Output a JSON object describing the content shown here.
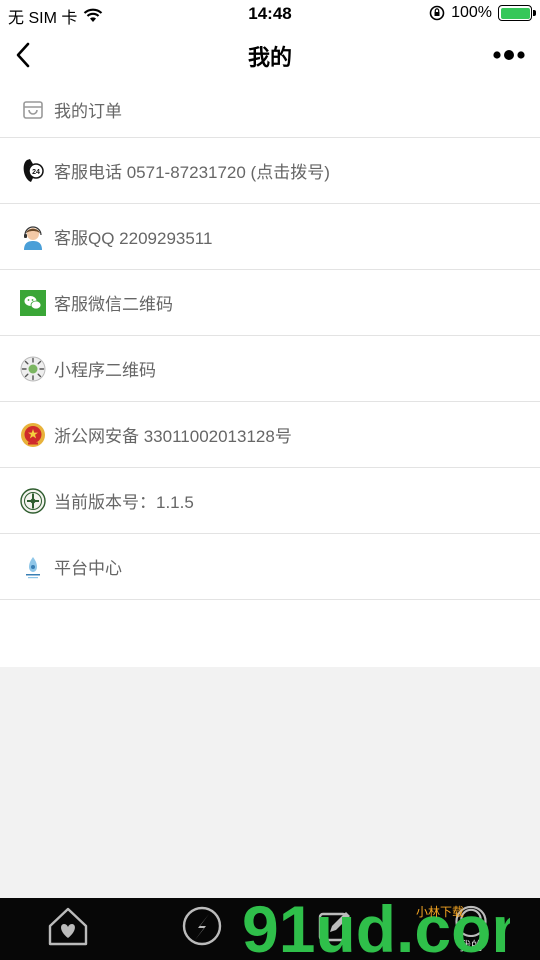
{
  "status_bar": {
    "carrier": "无 SIM 卡",
    "time": "14:48",
    "battery": "100%"
  },
  "navbar": {
    "title": "我的"
  },
  "menu": [
    {
      "label": "我的订单",
      "icon": "shop-bag-icon"
    },
    {
      "label": "客服电话 0571-87231720 (点击拨号)",
      "icon": "phone-24h-icon"
    },
    {
      "label": "客服QQ 2209293511",
      "icon": "support-agent-icon"
    },
    {
      "label": "客服微信二维码",
      "icon": "wechat-icon"
    },
    {
      "label": "小程序二维码",
      "icon": "mini-program-code-icon"
    },
    {
      "label": "浙公网安备 33011002013128号",
      "icon": "police-badge-icon"
    },
    {
      "label": "当前版本号：1.1.5",
      "icon": "version-badge-icon"
    },
    {
      "label": "平台中心",
      "icon": "platform-logo-icon"
    }
  ],
  "tabbar": {
    "active_label": "我的"
  },
  "watermark": {
    "text": "91ud.com",
    "sub": "小林下载"
  },
  "colors": {
    "battery_green": "#35c759",
    "wechat_green": "#3aa637",
    "watermark_green": "#2fbf4a",
    "watermark_orange": "#f5a623"
  }
}
